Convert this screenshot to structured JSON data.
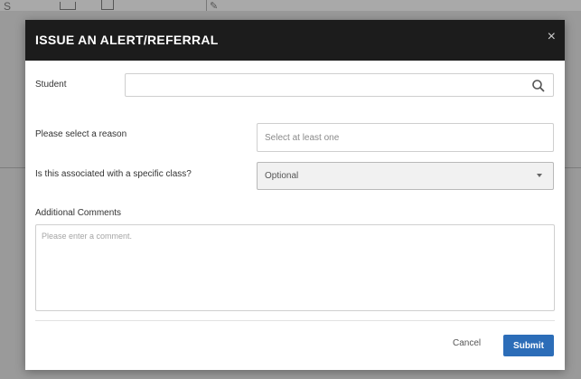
{
  "background": {
    "partial_text": "S",
    "icons": [
      "mail-icon",
      "document-icon",
      "pencil-icon"
    ]
  },
  "modal": {
    "title": "ISSUE AN ALERT/REFERRAL",
    "close_glyph": "×",
    "student": {
      "label": "Student",
      "value": "",
      "icon": "search-icon"
    },
    "reason": {
      "label": "Please select a reason",
      "placeholder": "Select at least one"
    },
    "class": {
      "label": "Is this associated with a specific class?",
      "selected": "Optional"
    },
    "comments": {
      "label": "Additional Comments",
      "placeholder": "Please enter a comment."
    },
    "buttons": {
      "cancel": "Cancel",
      "submit": "Submit"
    }
  },
  "colors": {
    "header_bg": "#1c1c1c",
    "submit_bg": "#2c6db8",
    "overlay": "#8e8e8e"
  }
}
